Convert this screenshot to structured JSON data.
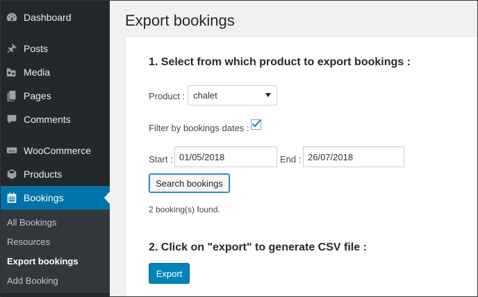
{
  "sidebar": {
    "items": [
      {
        "label": "Dashboard",
        "icon": "dashboard-icon"
      },
      {
        "label": "Posts",
        "icon": "pushpin-icon"
      },
      {
        "label": "Media",
        "icon": "media-icon"
      },
      {
        "label": "Pages",
        "icon": "pages-icon"
      },
      {
        "label": "Comments",
        "icon": "comment-icon"
      },
      {
        "label": "WooCommerce",
        "icon": "woocommerce-icon"
      },
      {
        "label": "Products",
        "icon": "products-icon"
      },
      {
        "label": "Bookings",
        "icon": "calendar-icon",
        "active": true
      }
    ],
    "submenu": [
      {
        "label": "All Bookings"
      },
      {
        "label": "Resources"
      },
      {
        "label": "Export bookings",
        "current": true
      },
      {
        "label": "Add Booking"
      }
    ]
  },
  "page": {
    "title": "Export bookings",
    "section1_title": "1. Select from which product to export bookings :",
    "product_label": "Product :",
    "product_value": "chalet",
    "filter_label": "Filter by bookings dates :",
    "filter_checked": true,
    "start_label": "Start :",
    "start_value": "01/05/2018",
    "end_label": "End :",
    "end_value": "26/07/2018",
    "search_button": "Search bookings",
    "result_text": "2 booking(s) found.",
    "section2_title": "2. Click on \"export\" to generate CSV file :",
    "export_button": "Export"
  },
  "colors": {
    "sidebar_bg": "#23282d",
    "active_bg": "#0073aa",
    "primary_button": "#0085ba"
  }
}
